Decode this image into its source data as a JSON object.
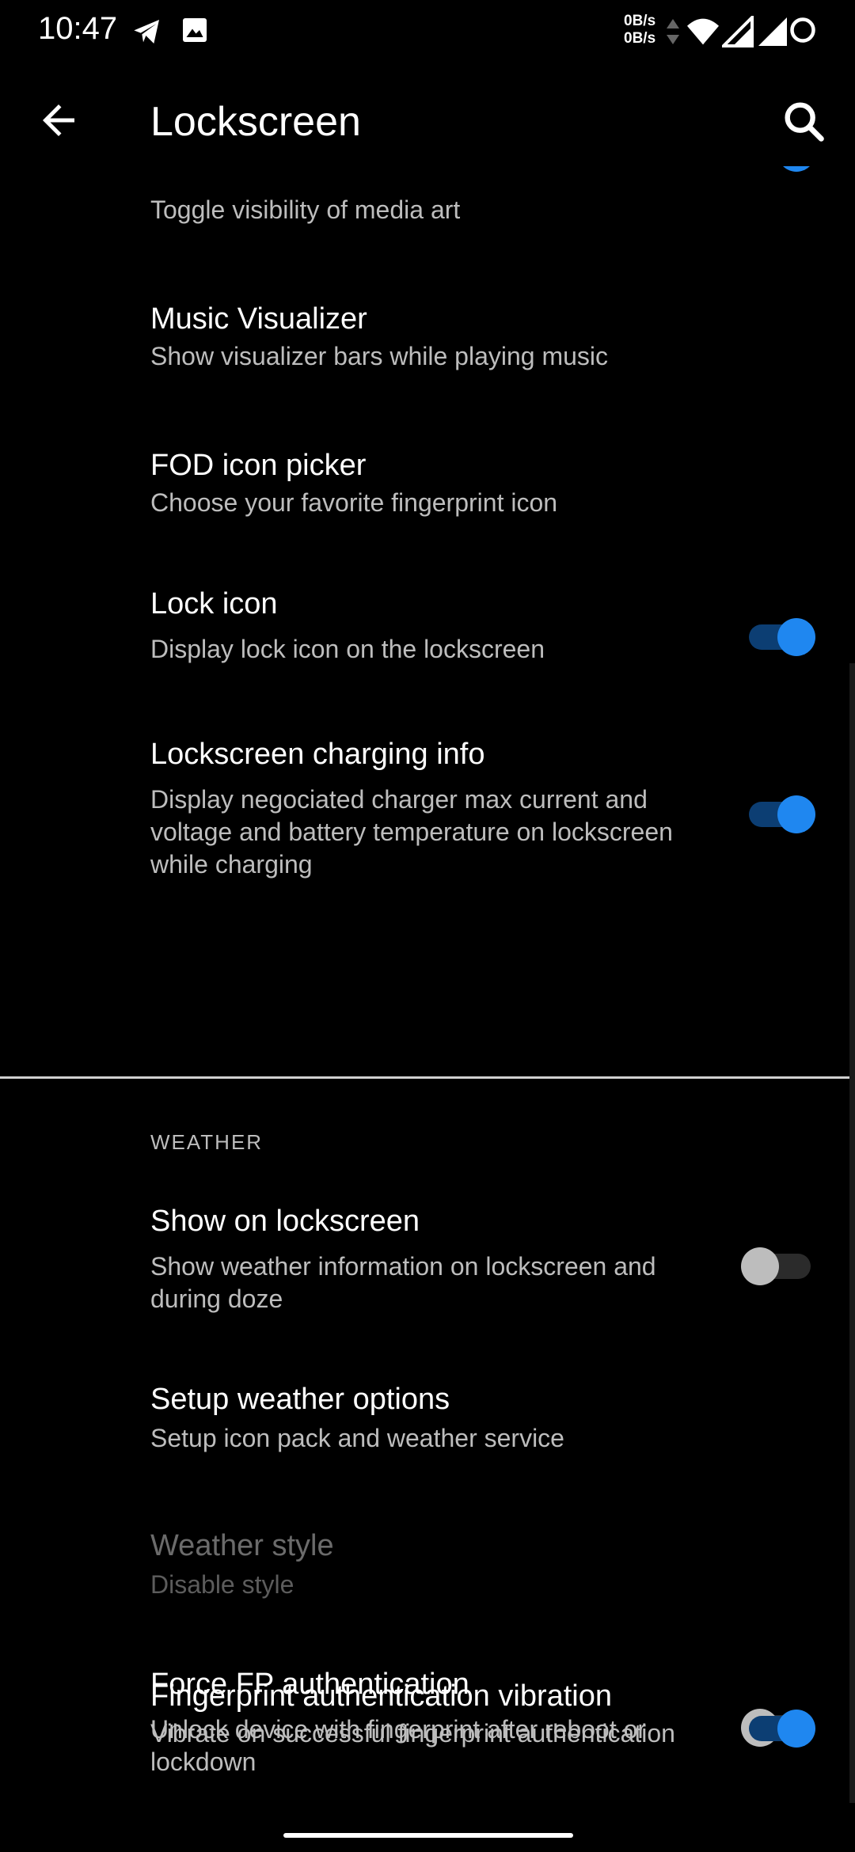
{
  "status_bar": {
    "time": "10:47",
    "net_up": "0B/s",
    "net_down": "0B/s",
    "icons": [
      "telegram-icon",
      "gallery-icon",
      "wifi-icon",
      "signal-icon",
      "signal-icon",
      "battery-ring-icon"
    ]
  },
  "app_bar": {
    "title": "Lockscreen",
    "back_icon": "arrow-back-icon",
    "search_icon": "search-icon"
  },
  "settings": [
    {
      "subtitle": "Toggle visibility of media art",
      "switch": true,
      "partial": true
    },
    {
      "title": "Music Visualizer",
      "subtitle": "Show visualizer bars while playing music"
    },
    {
      "title": "FOD icon picker",
      "subtitle": "Choose your favorite fingerprint icon"
    },
    {
      "title": "Lock icon",
      "subtitle": "Display lock icon on the lockscreen",
      "switch": true
    },
    {
      "title": "Lockscreen charging info",
      "subtitle": "Display negociated charger max current and voltage and battery temperature on lockscreen while charging",
      "switch": true
    }
  ],
  "weather_section": {
    "header": "WEATHER",
    "items": [
      {
        "title": "Show on lockscreen",
        "subtitle": "Show weather information on lockscreen and during doze",
        "switch": false
      },
      {
        "title": "Setup weather options",
        "subtitle": "Setup icon pack and weather service"
      },
      {
        "title": "Weather style",
        "subtitle": "Disable style",
        "disabled": true
      },
      {
        "title": "Force FP authentication",
        "subtitle": "Unlock device with fingerprint after reboot or lockdown",
        "switch": false
      },
      {
        "title": "Fingerprint authentication vibration",
        "subtitle": "Vibrate on successful fingerprint authentication",
        "switch": true
      }
    ]
  },
  "colors": {
    "background": "#000000",
    "accent": "#1f87f0",
    "switch_track_on": "#0c3e73",
    "switch_off_thumb": "#bdbdbd",
    "secondary_text": "#bdbdbd",
    "disabled_text": "#6b6b6b"
  }
}
